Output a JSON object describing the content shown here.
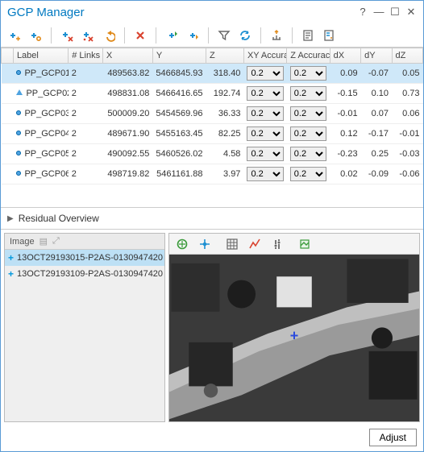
{
  "window": {
    "title": "GCP Manager",
    "buttons": {
      "help": "?",
      "min": "—",
      "max": "☐",
      "close": "✕"
    }
  },
  "toolbar": {
    "items": [
      "add-gcp",
      "add-tie",
      "sep",
      "delete-selected",
      "delete-all",
      "undo",
      "sep",
      "delete-x",
      "sep",
      "import",
      "export",
      "sep",
      "filter",
      "refresh",
      "sep",
      "measure",
      "sep",
      "report",
      "settings"
    ]
  },
  "table": {
    "headers": [
      "",
      "Label",
      "# Links",
      "X",
      "Y",
      "Z",
      "XY Accuracy",
      "Z Accuracy",
      "dX",
      "dY",
      "dZ"
    ],
    "acc_options": [
      "0.2"
    ],
    "rows": [
      {
        "shape": "circle",
        "label": "PP_GCP01",
        "links": "2",
        "x": "489563.82",
        "y": "5466845.93",
        "z": "318.40",
        "xy": "0.2",
        "za": "0.2",
        "dx": "0.09",
        "dy": "-0.07",
        "dz": "0.05",
        "selected": true
      },
      {
        "shape": "tri",
        "label": "PP_GCP02",
        "links": "2",
        "x": "498831.08",
        "y": "5466416.65",
        "z": "192.74",
        "xy": "0.2",
        "za": "0.2",
        "dx": "-0.15",
        "dy": "0.10",
        "dz": "0.73"
      },
      {
        "shape": "circle",
        "label": "PP_GCP03",
        "links": "2",
        "x": "500009.20",
        "y": "5454569.96",
        "z": "36.33",
        "xy": "0.2",
        "za": "0.2",
        "dx": "-0.01",
        "dy": "0.07",
        "dz": "0.06"
      },
      {
        "shape": "circle",
        "label": "PP_GCP04",
        "links": "2",
        "x": "489671.90",
        "y": "5455163.45",
        "z": "82.25",
        "xy": "0.2",
        "za": "0.2",
        "dx": "0.12",
        "dy": "-0.17",
        "dz": "-0.01"
      },
      {
        "shape": "circle",
        "label": "PP_GCP05",
        "links": "2",
        "x": "490092.55",
        "y": "5460526.02",
        "z": "4.58",
        "xy": "0.2",
        "za": "0.2",
        "dx": "-0.23",
        "dy": "0.25",
        "dz": "-0.03"
      },
      {
        "shape": "circle",
        "label": "PP_GCP06",
        "links": "2",
        "x": "498719.82",
        "y": "5461161.88",
        "z": "3.97",
        "xy": "0.2",
        "za": "0.2",
        "dx": "0.02",
        "dy": "-0.09",
        "dz": "-0.06"
      }
    ]
  },
  "residual": {
    "label": "Residual Overview"
  },
  "images": {
    "label": "Image",
    "items": [
      {
        "name": "13OCT29193015-P2AS-0130947420",
        "selected": true
      },
      {
        "name": "13OCT29193109-P2AS-0130947420"
      }
    ]
  },
  "viewer": {
    "tools": [
      "zoom-full",
      "pan",
      "sep",
      "grid",
      "profile",
      "link",
      "sep",
      "layers"
    ]
  },
  "footer": {
    "adjust": "Adjust"
  }
}
